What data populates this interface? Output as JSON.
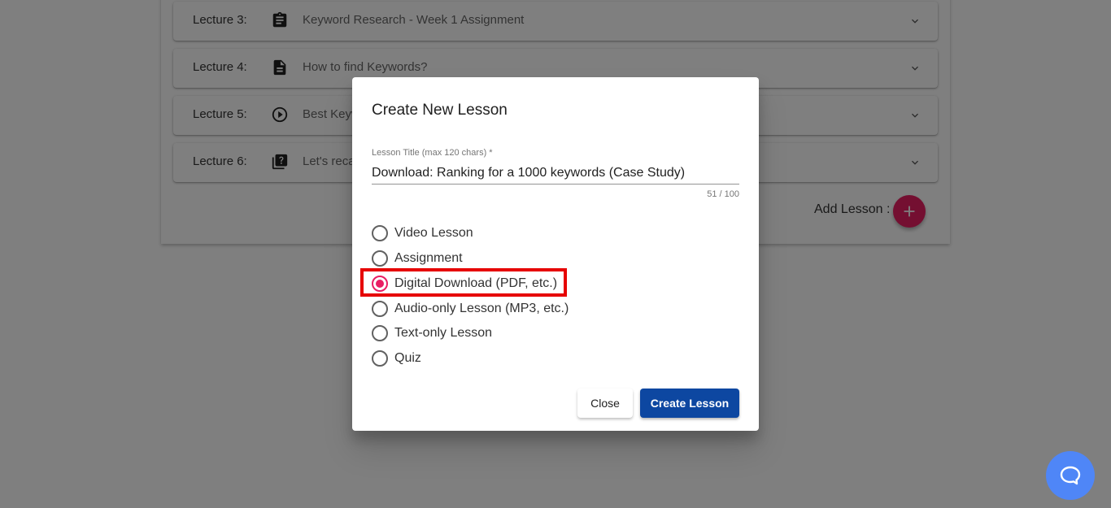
{
  "background": {
    "lectures": [
      {
        "number": "Lecture 3:",
        "icon": "assignment-icon",
        "title": "Keyword Research - Week 1 Assignment"
      },
      {
        "number": "Lecture 4:",
        "icon": "document-icon",
        "title": "How to find Keywords?"
      },
      {
        "number": "Lecture 5:",
        "icon": "play-circle-icon",
        "title": "Best Keyw"
      },
      {
        "number": "Lecture 6:",
        "icon": "quiz-icon",
        "title": "Let's reca"
      }
    ],
    "add_lesson_label": "Add Lesson :"
  },
  "dialog": {
    "title": "Create New Lesson",
    "field_label": "Lesson Title (max 120 chars) *",
    "field_value": "Download: Ranking for a 1000 keywords (Case Study)",
    "char_counter": "51 / 100",
    "options": [
      {
        "label": "Video Lesson",
        "selected": false
      },
      {
        "label": "Assignment",
        "selected": false
      },
      {
        "label": "Digital Download (PDF, etc.)",
        "selected": true
      },
      {
        "label": "Audio-only Lesson (MP3, etc.)",
        "selected": false
      },
      {
        "label": "Text-only Lesson",
        "selected": false
      },
      {
        "label": "Quiz",
        "selected": false
      }
    ],
    "close_label": "Close",
    "create_label": "Create Lesson"
  },
  "colors": {
    "accent": "#e91e63",
    "primary_button": "#0d47a1",
    "highlight": "#e60000",
    "chat_bubble": "#4f86f7"
  }
}
